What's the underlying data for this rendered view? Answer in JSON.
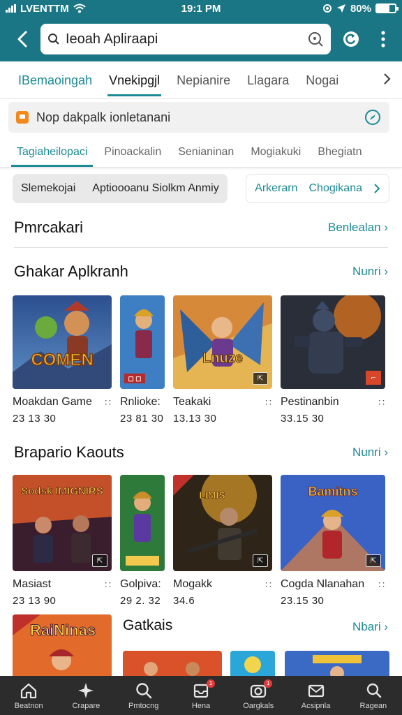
{
  "status_bar": {
    "carrier": "LVENTTM",
    "time": "19:1 PM",
    "battery_text": "80%"
  },
  "search": {
    "value": "Ieoah Apliraapi"
  },
  "top_tabs": [
    {
      "label": "IBemaoingah",
      "state": "teal"
    },
    {
      "label": "Vnekipgjl",
      "state": "active"
    },
    {
      "label": "Nepianire",
      "state": ""
    },
    {
      "label": "Llagara",
      "state": ""
    },
    {
      "label": "Nogai",
      "state": ""
    }
  ],
  "notice": {
    "text": "Nop dakpalk ionletanani"
  },
  "sub_tabs": [
    {
      "label": "Tagiaheilopaci",
      "active": true
    },
    {
      "label": "Pinoackalin",
      "active": false
    },
    {
      "label": "Senianinan",
      "active": false
    },
    {
      "label": "Mogiakuki",
      "active": false
    },
    {
      "label": "Bhegiatn",
      "active": false
    }
  ],
  "chips": {
    "group": [
      "Slemekojai",
      "Aptioooanu Siolkm Anmiy"
    ],
    "links": [
      "Arkerarn",
      "Chogikana"
    ]
  },
  "section0": {
    "title": "Pmrcakari",
    "link": "Benlealan"
  },
  "section1": {
    "title": "Ghakar Aplkranh",
    "link": "Nunri",
    "items": [
      {
        "name": "Moakdan Game",
        "sub": "23 13 30"
      },
      {
        "name": "Rnlioke:",
        "sub": "23 81 30"
      },
      {
        "name": "Teakaki",
        "sub": "13.13 30"
      },
      {
        "name": "Pestinanbin",
        "sub": "33.15 30"
      }
    ]
  },
  "section2": {
    "title": "Brapario Kaouts",
    "link": "Nunri",
    "items": [
      {
        "name": "Masiast",
        "sub": "23 13 90"
      },
      {
        "name": "Golpiva:",
        "sub": "29 2. 32"
      },
      {
        "name": "Mogakk",
        "sub": "34.6"
      },
      {
        "name": "Cogda Nlanahan",
        "sub": "23.15 30"
      }
    ]
  },
  "section3": {
    "title": "Gatkais",
    "link": "Nbari"
  },
  "artwork_text": {
    "art1": "COMEN",
    "art3": "Lnuze",
    "art5": "Sodsk IMIGNIRS",
    "art7": "LIMIS",
    "art8": "Bamitns",
    "promo1": "RaiNinas"
  },
  "bottom_nav": [
    {
      "label": "Beatnon",
      "icon": "home-icon",
      "badge": ""
    },
    {
      "label": "Crapare",
      "icon": "star-icon",
      "badge": ""
    },
    {
      "label": "Pmtocng",
      "icon": "search-icon",
      "badge": ""
    },
    {
      "label": "Hena",
      "icon": "inbox-icon",
      "badge": "1"
    },
    {
      "label": "Oargkals",
      "icon": "camera-icon",
      "badge": "1"
    },
    {
      "label": "Acsipnla",
      "icon": "mail-icon",
      "badge": ""
    },
    {
      "label": "Ragean",
      "icon": "profile-icon",
      "badge": ""
    }
  ],
  "colors": {
    "primary": "#1a7585",
    "accent": "#1a8a95",
    "nav": "#2c2c2c"
  }
}
